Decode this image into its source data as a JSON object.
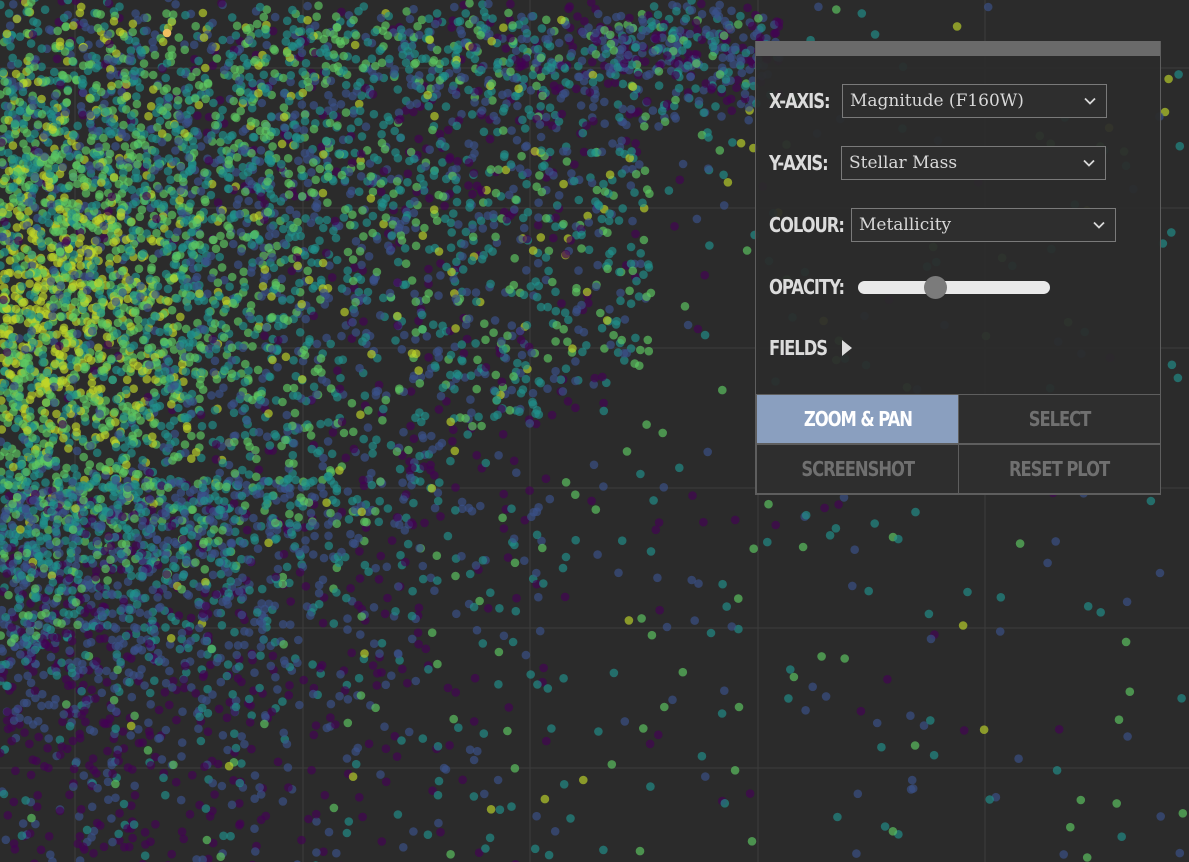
{
  "controls": {
    "x_axis": {
      "label": "X-AXIS:",
      "value": "Magnitude (F160W)"
    },
    "y_axis": {
      "label": "Y-AXIS:",
      "value": "Stellar Mass"
    },
    "colour": {
      "label": "COLOUR:",
      "value": "Metallicity"
    },
    "opacity": {
      "label": "OPACITY:",
      "value": 0.4
    },
    "fields": {
      "label": "FIELDS",
      "expanded": false
    }
  },
  "buttons": {
    "zoom_pan": {
      "label": "ZOOM & PAN",
      "active": true
    },
    "select": {
      "label": "SELECT",
      "active": false
    },
    "screenshot": {
      "label": "SCREENSHOT",
      "active": false
    },
    "reset_plot": {
      "label": "RESET PLOT",
      "active": false
    }
  },
  "icons": {
    "dropdown": "chevron-down-icon",
    "fields_toggle": "caret-right-icon"
  },
  "colors": {
    "background": "#2b2b2b",
    "gridline": "#3c3c3c",
    "panel_bar": "#6a6a6a",
    "active_button": "#8a9fbf",
    "colormap": [
      "#440154",
      "#3b528b",
      "#21918c",
      "#5ec962",
      "#bfd62a"
    ],
    "highlight_point": "#f0c060"
  },
  "chart_data": {
    "type": "scatter",
    "title": "",
    "xlabel": "",
    "ylabel": "",
    "grid": true,
    "legend": "none",
    "colormap": "viridis"
  }
}
